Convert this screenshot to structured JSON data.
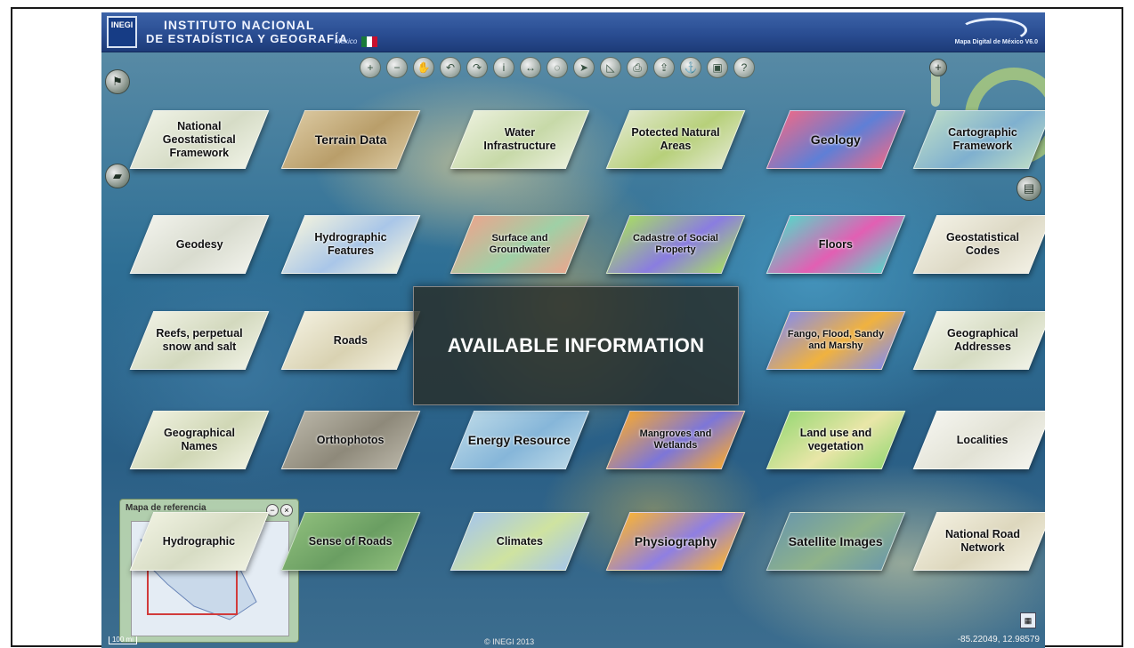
{
  "header": {
    "logo_text": "INEGI",
    "institute_line1": "INSTITUTO NACIONAL",
    "institute_line2": "DE ESTADÍSTICA Y GEOGRAFÍA",
    "country_text": "México",
    "app_version": "Mapa Digital de México V6.0"
  },
  "toolbar": {
    "tools": [
      {
        "icon": "zoom-in-icon",
        "glyph": "+"
      },
      {
        "icon": "zoom-out-icon",
        "glyph": "−"
      },
      {
        "icon": "pan-icon",
        "glyph": "✋"
      },
      {
        "icon": "back-icon",
        "glyph": "↶"
      },
      {
        "icon": "forward-icon",
        "glyph": "↷"
      },
      {
        "icon": "info-icon",
        "glyph": "i"
      },
      {
        "icon": "measure-icon",
        "glyph": "↔"
      },
      {
        "icon": "select-icon",
        "glyph": "◌"
      },
      {
        "icon": "route-icon",
        "glyph": "➤"
      },
      {
        "icon": "draw-icon",
        "glyph": "◺"
      },
      {
        "icon": "print-icon",
        "glyph": "⎙"
      },
      {
        "icon": "export-icon",
        "glyph": "⇪"
      },
      {
        "icon": "link-icon",
        "glyph": "⚓"
      },
      {
        "icon": "camera-icon",
        "glyph": "▣"
      },
      {
        "icon": "help-icon",
        "glyph": "?"
      }
    ]
  },
  "side_controls": {
    "layers_icon": "⚑",
    "legend_icon": "▰",
    "right_top_icon": "▤",
    "right_bottom_icon": "⚲",
    "zoom_plus": "+",
    "zoom_minus": "−"
  },
  "center_panel": {
    "title": "AVAILABLE INFORMATION"
  },
  "cards": [
    {
      "label": "National Geostatistical Framework",
      "color": "#eef1e4",
      "accent": "#d6dcc6"
    },
    {
      "label": "Terrain Data",
      "color": "#d8c59c",
      "accent": "#b99e6a"
    },
    {
      "label": "Water Infrastructure",
      "color": "#e9efd9",
      "accent": "#c7d9a8"
    },
    {
      "label": "Potected Natural Areas",
      "color": "#dfe7c8",
      "accent": "#b7d07a"
    },
    {
      "label": "Geology",
      "color": "#e36b8e",
      "accent": "#5f7fd6"
    },
    {
      "label": "Cartographic Framework",
      "color": "#b8d9c8",
      "accent": "#7fb0cf"
    },
    {
      "label": "Geodesy",
      "color": "#f0f1ea",
      "accent": "#d9dccf"
    },
    {
      "label": "Hydrographic Features",
      "color": "#eef0df",
      "accent": "#a9c6e8"
    },
    {
      "label": "Surface and Groundwater",
      "color": "#e7a88f",
      "accent": "#9fd0a6"
    },
    {
      "label": "Cadastre of Social Property",
      "color": "#a7d86a",
      "accent": "#8a7de0"
    },
    {
      "label": "Floors",
      "color": "#5fd0c8",
      "accent": "#e25fb3"
    },
    {
      "label": "Geostatistical Codes",
      "color": "#f2f0e4",
      "accent": "#ddd9c5"
    },
    {
      "label": "Reefs, perpetual snow and salt",
      "color": "#eef0e2",
      "accent": "#d3d9be"
    },
    {
      "label": "Roads",
      "color": "#f1eedc",
      "accent": "#d9d2b2"
    },
    {
      "label": "Fango, Flood, Sandy and Marshy",
      "color": "#8e8fe0",
      "accent": "#f0b23f"
    },
    {
      "label": "Geographical Addresses",
      "color": "#f0f2e6",
      "accent": "#d6dcc2"
    },
    {
      "label": "Geographical Names",
      "color": "#eef0de",
      "accent": "#d0d7b5"
    },
    {
      "label": "Orthophotos",
      "color": "#b6b2a4",
      "accent": "#8e897a"
    },
    {
      "label": "Energy Resource",
      "color": "#b7d6e6",
      "accent": "#86b6d9"
    },
    {
      "label": "Mangroves and Wetlands",
      "color": "#f1a63a",
      "accent": "#7d76d8"
    },
    {
      "label": "Land use and vegetation",
      "color": "#9ed978",
      "accent": "#e9e6a8"
    },
    {
      "label": "Localities",
      "color": "#f4f4ee",
      "accent": "#e2e2d5"
    },
    {
      "label": "Hydrographic",
      "color": "#eef0df",
      "accent": "#d7dcc4"
    },
    {
      "label": "Sense of Roads",
      "color": "#8cbc7a",
      "accent": "#6a9e62"
    },
    {
      "label": "Climates",
      "color": "#a9c8e6",
      "accent": "#cfe3a0"
    },
    {
      "label": "Physiography",
      "color": "#f5b13c",
      "accent": "#8f7fe2"
    },
    {
      "label": "Satellite Images",
      "color": "#6d9aa8",
      "accent": "#8fb38a"
    },
    {
      "label": "National Road Network",
      "color": "#f2efdf",
      "accent": "#ddd7bd"
    }
  ],
  "mini_window": {
    "title": "Mapa de referencia",
    "minimize": "−",
    "close": "×"
  },
  "status": {
    "scale_text": "100 mi",
    "copyright_text": "© INEGI 2013",
    "coordinates": "-85.22049, 12.98579"
  }
}
